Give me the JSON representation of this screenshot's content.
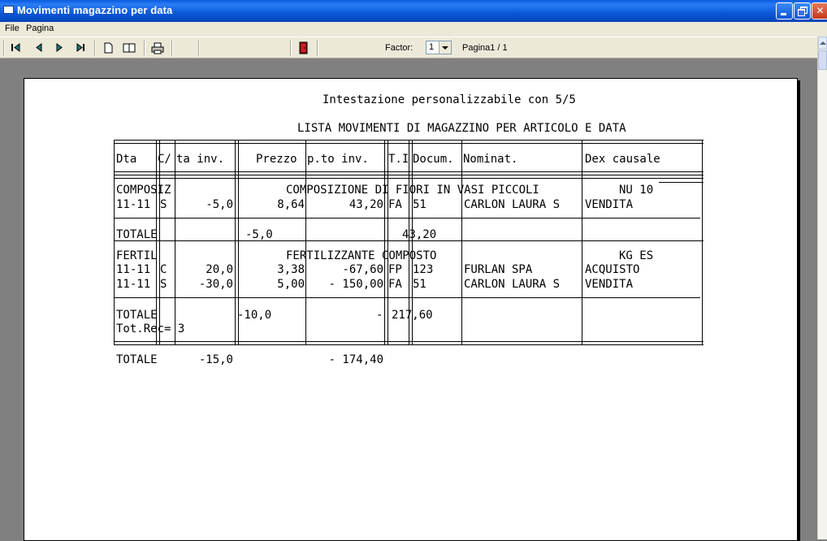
{
  "window": {
    "title": "Movimenti magazzino per data",
    "min_glyph": "_",
    "close_glyph": "✕"
  },
  "menu": [
    "File",
    "Pagina"
  ],
  "toolbar": {
    "factor_label": "Factor:",
    "factor_value": "1",
    "page_label": "Pagina1 / 1",
    "icons": [
      "first-page-icon",
      "prev-page-icon",
      "next-page-icon",
      "last-page-icon",
      "single-page-icon",
      "two-page-icon",
      "print-icon",
      "exit-icon"
    ]
  },
  "report": {
    "header": "Intestazione personalizzabile con 5/5",
    "title": "LISTA MOVIMENTI DI MAGAZZINO PER ARTICOLO E DATA",
    "columns": [
      "Dta",
      "C/",
      "ta inv.",
      "Prezzo",
      "p.to inv.",
      "T.I",
      "Docum.",
      "Nominat.",
      "Dex causale"
    ],
    "groups": [
      {
        "code": "COMPOSIZ",
        "description": "COMPOSIZIONE DI FIORI IN VASI PICCOLI",
        "unit": "NU 10",
        "rows": [
          [
            "11-11",
            "S",
            "-5,0",
            "8,64",
            "43,20",
            "FA",
            "51",
            "CARLON LAURA S",
            "VENDITA"
          ]
        ],
        "total_label": "TOTALE",
        "total_qty": "-5,0",
        "total_amount": "43,20"
      },
      {
        "code": "FERTIL",
        "description": "FERTILIZZANTE COMPOSTO",
        "unit": "KG ES",
        "rows": [
          [
            "11-11",
            "C",
            "20,0",
            "3,38",
            "-67,60",
            "FP",
            "123",
            "FURLAN SPA",
            "ACQUISTO"
          ],
          [
            "11-11",
            "S",
            "-30,0",
            "5,00",
            "- 150,00",
            "FA",
            "51",
            "CARLON LAURA S",
            "VENDITA"
          ]
        ],
        "total_label": "TOTALE",
        "total_qty": "-10,0",
        "total_amount_sign": "-",
        "total_amount": "217,60",
        "rec_label": "Tot.Rec= 3"
      }
    ],
    "grand_total": {
      "label": "TOTALE",
      "qty": "-15,0",
      "amount": "- 174,40"
    }
  }
}
